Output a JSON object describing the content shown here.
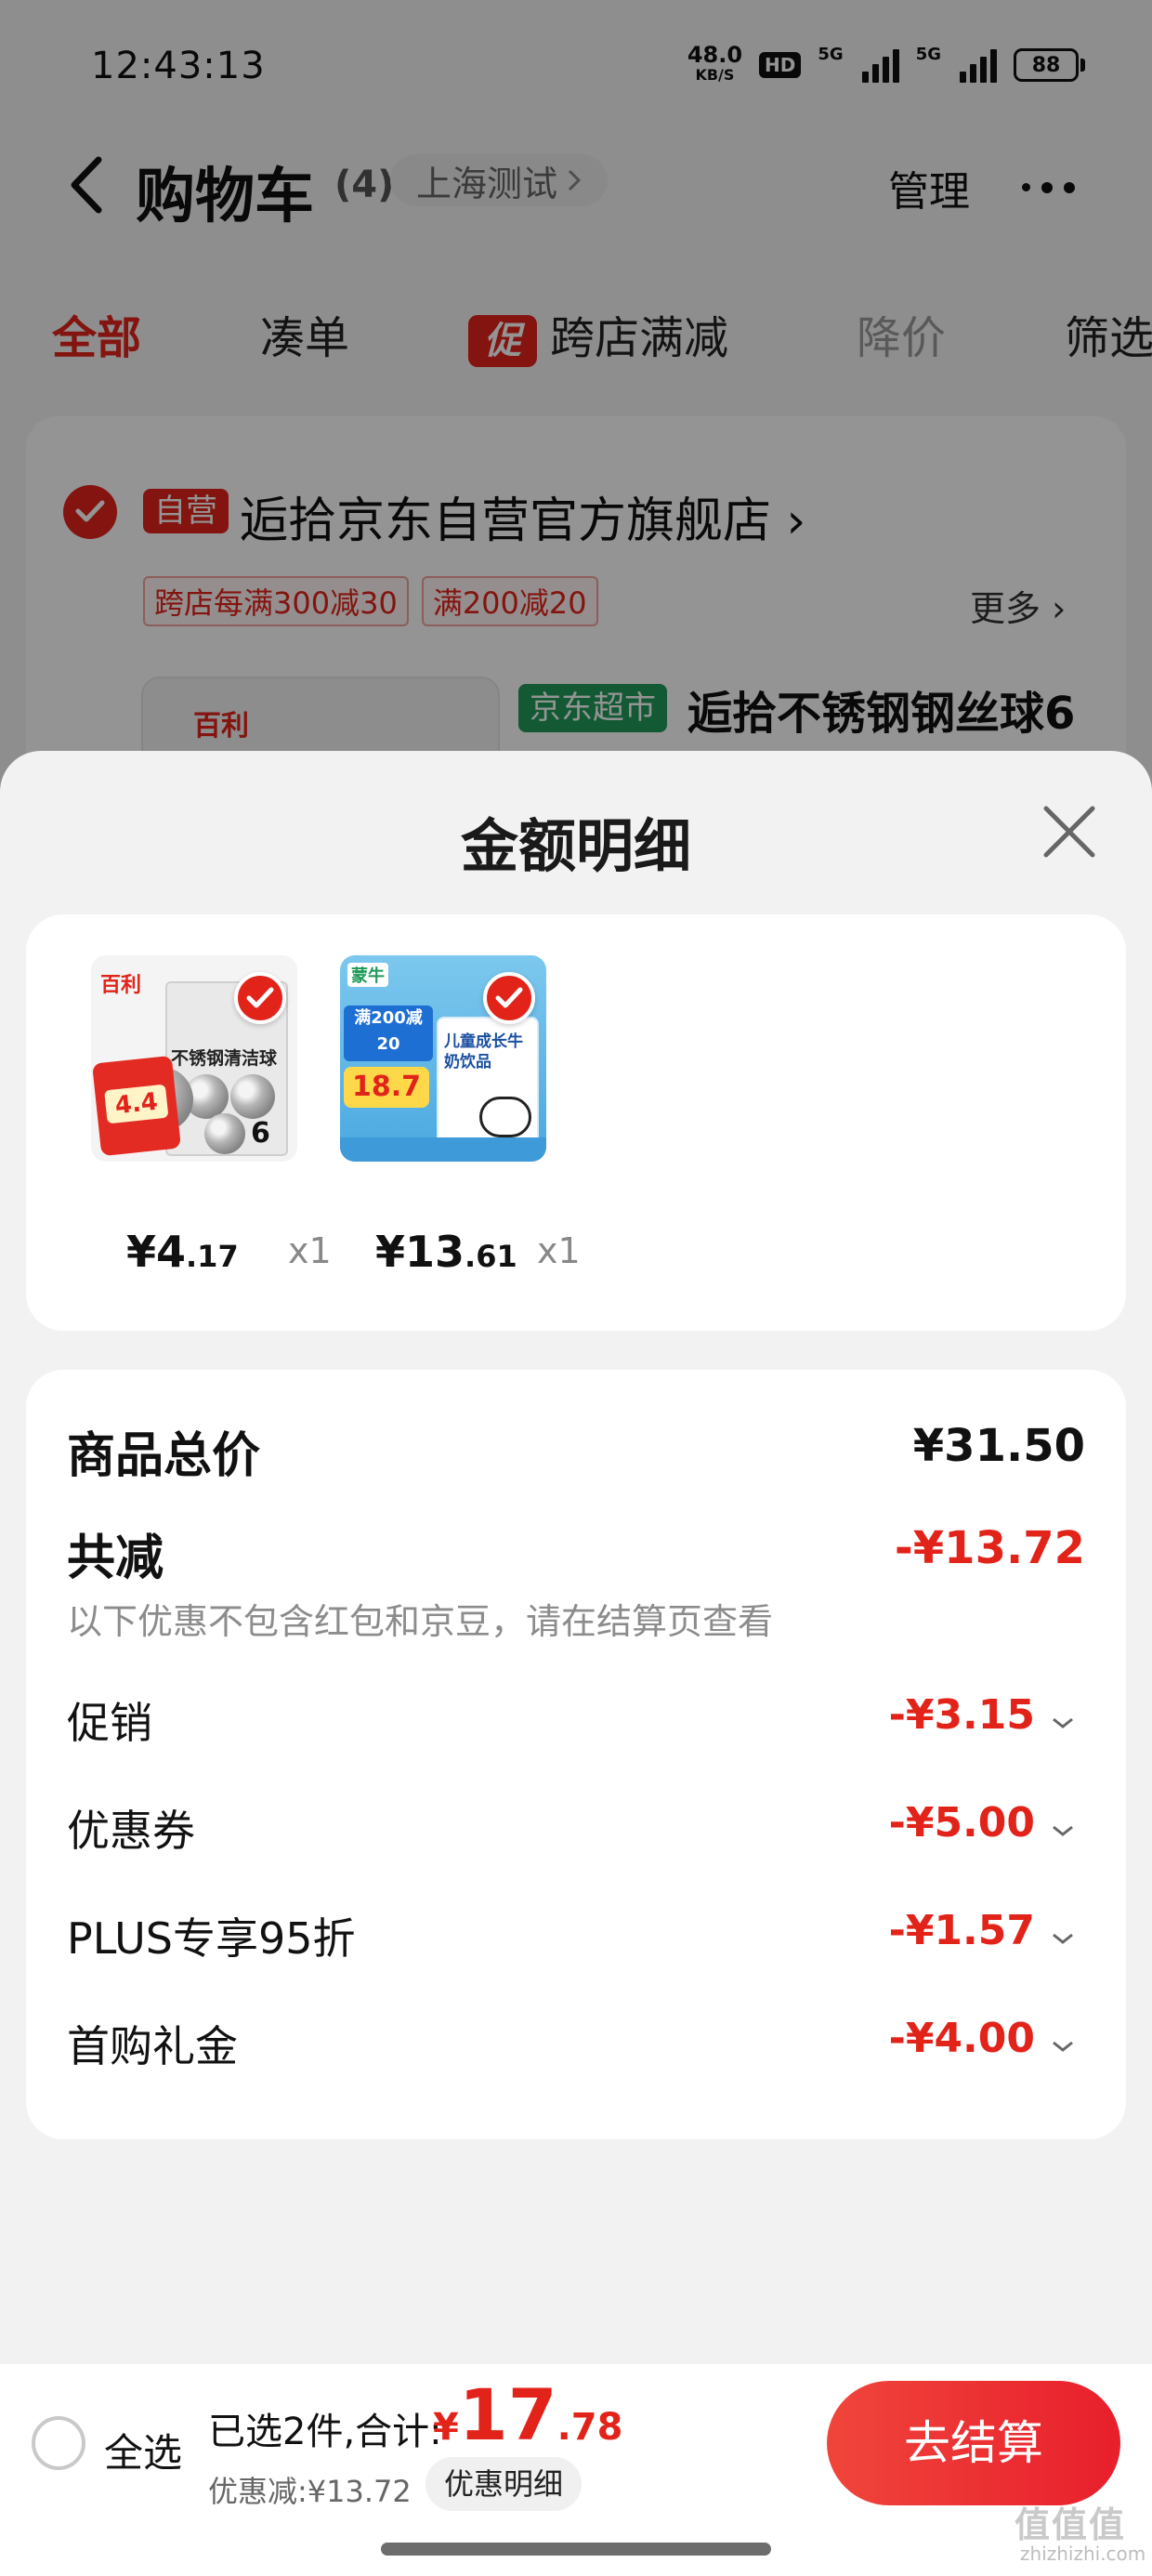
{
  "status_bar": {
    "time": "12:43:13",
    "net_speed": "48.0",
    "net_unit": "KB/S",
    "hd": "HD",
    "signal1": "5G",
    "signal2": "5G",
    "battery": "88"
  },
  "header": {
    "title": "购物车",
    "count": "(4)",
    "location": "上海测试",
    "manage": "管理"
  },
  "tabs": [
    {
      "label": "全部",
      "active": true
    },
    {
      "label": "凑单"
    },
    {
      "label": "跨店满减",
      "badge": "促"
    },
    {
      "label": "降价"
    },
    {
      "label": "筛选"
    }
  ],
  "store": {
    "self_badge": "自营",
    "name": "逅拾京东自营官方旗舰店",
    "promos": [
      "跨店每满300减30",
      "满200减20"
    ],
    "more": "更多",
    "bg_product_brand": "百利",
    "bg_product_tag": "京东超市",
    "bg_product_title": "逅拾不锈钢钢丝球6"
  },
  "sheet": {
    "title": "金额明细",
    "products": [
      {
        "price_int": "¥4",
        "price_dec": ".17",
        "qty": "x1",
        "img": {
          "brand": "百利",
          "title": "不锈钢清洁球",
          "tag_price": "4.4",
          "count": "6"
        }
      },
      {
        "price_int": "¥13",
        "price_dec": ".61",
        "qty": "x1",
        "img": {
          "brand": "蒙牛",
          "banner": "满200减20",
          "price_badge": "18.7",
          "box_text": "儿童成长牛奶饮品"
        }
      }
    ],
    "detail": {
      "subtotal_label": "商品总价",
      "subtotal_value": "¥31.50",
      "reduce_label": "共减",
      "reduce_value": "-¥13.72",
      "note": "以下优惠不包含红包和京豆，请在结算页查看",
      "items": [
        {
          "label": "促销",
          "value": "-¥3.15"
        },
        {
          "label": "优惠券",
          "value": "-¥5.00"
        },
        {
          "label": "PLUS专享95折",
          "value": "-¥1.57"
        },
        {
          "label": "首购礼金",
          "value": "-¥4.00"
        }
      ]
    }
  },
  "checkout": {
    "select_all": "全选",
    "summary": "已选2件,合计:",
    "total_sym": "¥",
    "total_int": "17",
    "total_dec": ".78",
    "discount": "优惠减:¥13.72",
    "detail_button": "优惠明细",
    "checkout_button": "去结算"
  },
  "watermark": {
    "main": "值值值",
    "sub": "zhizhizhi.com"
  },
  "colors": {
    "accent": "#e2231a",
    "sheet_bg": "#f2f2f2",
    "card_bg": "#ffffff"
  }
}
